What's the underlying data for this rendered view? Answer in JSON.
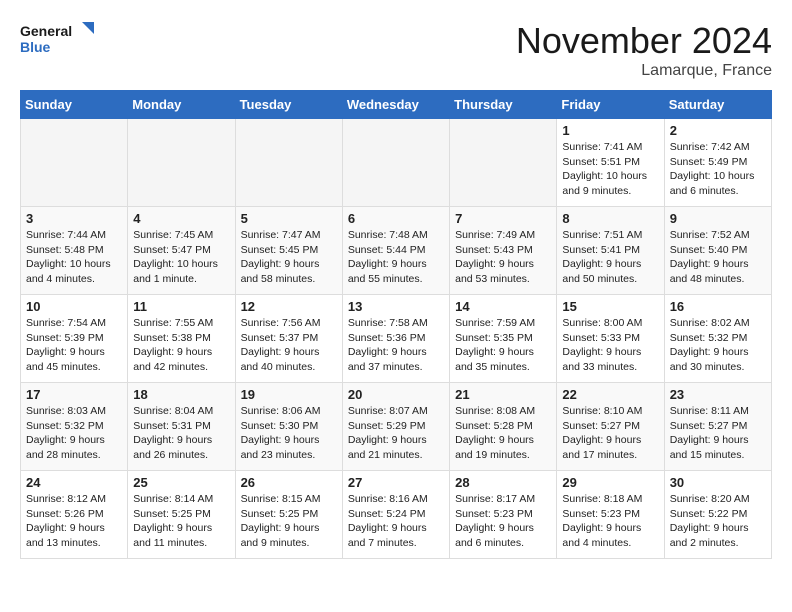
{
  "header": {
    "logo_line1": "General",
    "logo_line2": "Blue",
    "month": "November 2024",
    "location": "Lamarque, France"
  },
  "weekdays": [
    "Sunday",
    "Monday",
    "Tuesday",
    "Wednesday",
    "Thursday",
    "Friday",
    "Saturday"
  ],
  "weeks": [
    [
      {
        "day": "",
        "info": ""
      },
      {
        "day": "",
        "info": ""
      },
      {
        "day": "",
        "info": ""
      },
      {
        "day": "",
        "info": ""
      },
      {
        "day": "",
        "info": ""
      },
      {
        "day": "1",
        "info": "Sunrise: 7:41 AM\nSunset: 5:51 PM\nDaylight: 10 hours and 9 minutes."
      },
      {
        "day": "2",
        "info": "Sunrise: 7:42 AM\nSunset: 5:49 PM\nDaylight: 10 hours and 6 minutes."
      }
    ],
    [
      {
        "day": "3",
        "info": "Sunrise: 7:44 AM\nSunset: 5:48 PM\nDaylight: 10 hours and 4 minutes."
      },
      {
        "day": "4",
        "info": "Sunrise: 7:45 AM\nSunset: 5:47 PM\nDaylight: 10 hours and 1 minute."
      },
      {
        "day": "5",
        "info": "Sunrise: 7:47 AM\nSunset: 5:45 PM\nDaylight: 9 hours and 58 minutes."
      },
      {
        "day": "6",
        "info": "Sunrise: 7:48 AM\nSunset: 5:44 PM\nDaylight: 9 hours and 55 minutes."
      },
      {
        "day": "7",
        "info": "Sunrise: 7:49 AM\nSunset: 5:43 PM\nDaylight: 9 hours and 53 minutes."
      },
      {
        "day": "8",
        "info": "Sunrise: 7:51 AM\nSunset: 5:41 PM\nDaylight: 9 hours and 50 minutes."
      },
      {
        "day": "9",
        "info": "Sunrise: 7:52 AM\nSunset: 5:40 PM\nDaylight: 9 hours and 48 minutes."
      }
    ],
    [
      {
        "day": "10",
        "info": "Sunrise: 7:54 AM\nSunset: 5:39 PM\nDaylight: 9 hours and 45 minutes."
      },
      {
        "day": "11",
        "info": "Sunrise: 7:55 AM\nSunset: 5:38 PM\nDaylight: 9 hours and 42 minutes."
      },
      {
        "day": "12",
        "info": "Sunrise: 7:56 AM\nSunset: 5:37 PM\nDaylight: 9 hours and 40 minutes."
      },
      {
        "day": "13",
        "info": "Sunrise: 7:58 AM\nSunset: 5:36 PM\nDaylight: 9 hours and 37 minutes."
      },
      {
        "day": "14",
        "info": "Sunrise: 7:59 AM\nSunset: 5:35 PM\nDaylight: 9 hours and 35 minutes."
      },
      {
        "day": "15",
        "info": "Sunrise: 8:00 AM\nSunset: 5:33 PM\nDaylight: 9 hours and 33 minutes."
      },
      {
        "day": "16",
        "info": "Sunrise: 8:02 AM\nSunset: 5:32 PM\nDaylight: 9 hours and 30 minutes."
      }
    ],
    [
      {
        "day": "17",
        "info": "Sunrise: 8:03 AM\nSunset: 5:32 PM\nDaylight: 9 hours and 28 minutes."
      },
      {
        "day": "18",
        "info": "Sunrise: 8:04 AM\nSunset: 5:31 PM\nDaylight: 9 hours and 26 minutes."
      },
      {
        "day": "19",
        "info": "Sunrise: 8:06 AM\nSunset: 5:30 PM\nDaylight: 9 hours and 23 minutes."
      },
      {
        "day": "20",
        "info": "Sunrise: 8:07 AM\nSunset: 5:29 PM\nDaylight: 9 hours and 21 minutes."
      },
      {
        "day": "21",
        "info": "Sunrise: 8:08 AM\nSunset: 5:28 PM\nDaylight: 9 hours and 19 minutes."
      },
      {
        "day": "22",
        "info": "Sunrise: 8:10 AM\nSunset: 5:27 PM\nDaylight: 9 hours and 17 minutes."
      },
      {
        "day": "23",
        "info": "Sunrise: 8:11 AM\nSunset: 5:27 PM\nDaylight: 9 hours and 15 minutes."
      }
    ],
    [
      {
        "day": "24",
        "info": "Sunrise: 8:12 AM\nSunset: 5:26 PM\nDaylight: 9 hours and 13 minutes."
      },
      {
        "day": "25",
        "info": "Sunrise: 8:14 AM\nSunset: 5:25 PM\nDaylight: 9 hours and 11 minutes."
      },
      {
        "day": "26",
        "info": "Sunrise: 8:15 AM\nSunset: 5:25 PM\nDaylight: 9 hours and 9 minutes."
      },
      {
        "day": "27",
        "info": "Sunrise: 8:16 AM\nSunset: 5:24 PM\nDaylight: 9 hours and 7 minutes."
      },
      {
        "day": "28",
        "info": "Sunrise: 8:17 AM\nSunset: 5:23 PM\nDaylight: 9 hours and 6 minutes."
      },
      {
        "day": "29",
        "info": "Sunrise: 8:18 AM\nSunset: 5:23 PM\nDaylight: 9 hours and 4 minutes."
      },
      {
        "day": "30",
        "info": "Sunrise: 8:20 AM\nSunset: 5:22 PM\nDaylight: 9 hours and 2 minutes."
      }
    ]
  ]
}
